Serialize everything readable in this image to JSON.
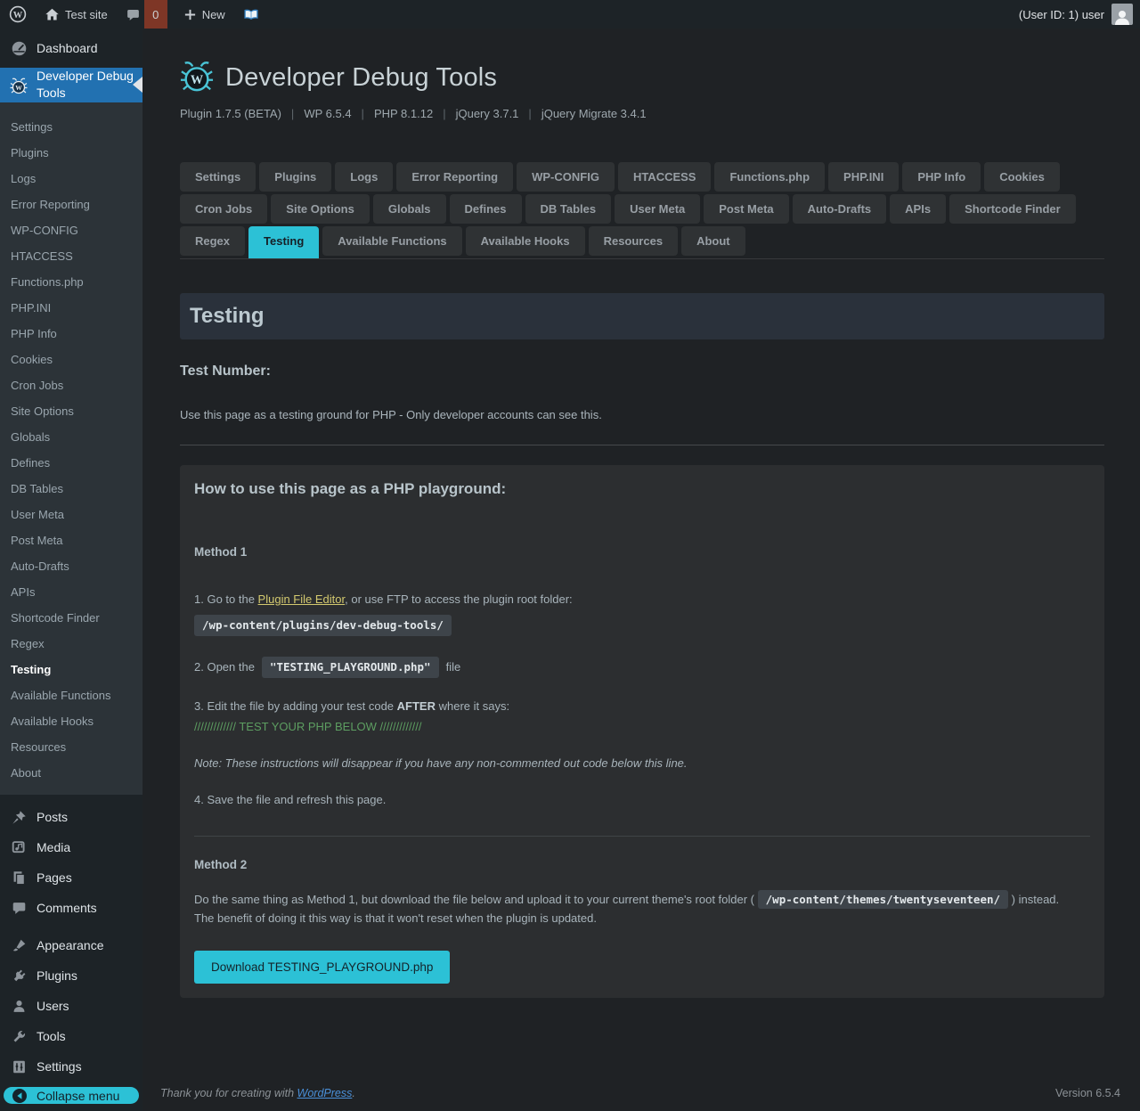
{
  "colors": {
    "accent_cyan": "#2cc1d6",
    "active_blue": "#2271b1",
    "link_yellow": "#d3c96f",
    "code_green": "#5d9e61",
    "footer_link_blue": "#4a90d9"
  },
  "topbar": {
    "site_name": "Test site",
    "pending_count": "0",
    "new_label": "New",
    "user_label": "(User ID: 1) user"
  },
  "sidebar": {
    "dashboard": "Dashboard",
    "ddt": "Developer Debug Tools",
    "submenu": [
      "Settings",
      "Plugins",
      "Logs",
      "Error Reporting",
      "WP-CONFIG",
      "HTACCESS",
      "Functions.php",
      "PHP.INI",
      "PHP Info",
      "Cookies",
      "Cron Jobs",
      "Site Options",
      "Globals",
      "Defines",
      "DB Tables",
      "User Meta",
      "Post Meta",
      "Auto-Drafts",
      "APIs",
      "Shortcode Finder",
      "Regex",
      "Testing",
      "Available Functions",
      "Available Hooks",
      "Resources",
      "About"
    ],
    "menu": [
      "Posts",
      "Media",
      "Pages",
      "Comments",
      "Appearance",
      "Plugins",
      "Users",
      "Tools",
      "Settings"
    ],
    "collapse": "Collapse menu"
  },
  "header": {
    "title": "Developer Debug Tools",
    "sep": "|",
    "meta": [
      "Plugin 1.7.5 (BETA)",
      "WP 6.5.4",
      "PHP 8.1.12",
      "jQuery 3.7.1",
      "jQuery Migrate 3.4.1"
    ]
  },
  "tabs": {
    "row1": [
      "Settings",
      "Plugins",
      "Logs",
      "Error Reporting",
      "WP-CONFIG",
      "HTACCESS",
      "Functions.php",
      "PHP.INI",
      "PHP Info",
      "Cookies"
    ],
    "row2": [
      "Cron Jobs",
      "Site Options",
      "Globals",
      "Defines",
      "DB Tables",
      "User Meta",
      "Post Meta",
      "Auto-Drafts",
      "APIs",
      "Shortcode Finder"
    ],
    "row3": [
      "Regex",
      "Testing",
      "Available Functions",
      "Available Hooks",
      "Resources",
      "About"
    ]
  },
  "main": {
    "panel_title": "Testing",
    "test_number_label": "Test Number:",
    "intro": "Use this page as a testing ground for PHP - Only developer accounts can see this.",
    "playground": {
      "heading": "How to use this page as a PHP playground:",
      "method1_label": "Method 1",
      "step1_pre": "1. Go to the ",
      "step1_link": "Plugin File Editor",
      "step1_post": ", or use FTP to access the plugin root folder:",
      "code_plugin_path": "/wp-content/plugins/dev-debug-tools/",
      "step2_pre": "2. Open the",
      "code_filename": "\"TESTING_PLAYGROUND.php\"",
      "step2_post": "file",
      "step3_pre": "3. Edit the file by adding your test code ",
      "step3_bold": "AFTER",
      "step3_post": " where it says:",
      "green_line": "///////////// TEST YOUR PHP BELOW /////////////",
      "note": "Note: These instructions will disappear if you have any non-commented out code below this line.",
      "step4": "4. Save the file and refresh this page.",
      "method2_label": "Method 2",
      "m2_pre": "Do the same thing as Method 1, but download the file below and upload it to your current theme's root folder (",
      "code_theme_path": "/wp-content/themes/twentyseventeen/",
      "m2_post": ") instead.",
      "m2_line2": "The benefit of doing it this way is that it won't reset when the plugin is updated.",
      "download_button": "Download TESTING_PLAYGROUND.php"
    }
  },
  "footer": {
    "thanks_pre": "Thank you for creating with ",
    "link": "WordPress",
    "period": ".",
    "version": "Version 6.5.4"
  }
}
